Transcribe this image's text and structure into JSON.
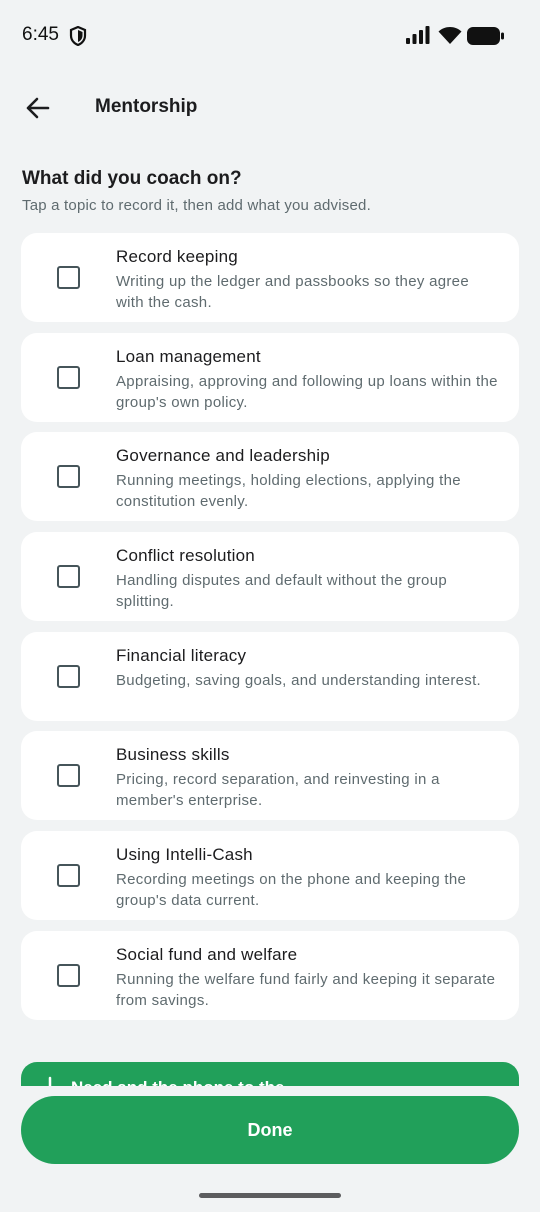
{
  "status_bar": {
    "time": "6:45",
    "icons": [
      "shield-icon",
      "signal-icon",
      "wifi-icon",
      "battery-icon"
    ]
  },
  "app_bar": {
    "back_icon": "arrow-back-icon",
    "title": "Mentorship"
  },
  "section": {
    "question": "What did you coach on?",
    "hint": "Tap a topic to record it, then add what you advised."
  },
  "topics": [
    {
      "title": "Record keeping",
      "desc": "Writing up the ledger and passbooks so they agree with the cash.",
      "checked": false
    },
    {
      "title": "Loan management",
      "desc": "Appraising, approving and following up loans within the group's own policy.",
      "checked": false
    },
    {
      "title": "Governance and leadership",
      "desc": "Running meetings, holding elections, applying the constitution evenly.",
      "checked": false
    },
    {
      "title": "Conflict resolution",
      "desc": "Handling disputes and default without the group splitting.",
      "checked": false
    },
    {
      "title": "Financial literacy",
      "desc": "Budgeting, saving goals, and understanding interest.",
      "checked": false
    },
    {
      "title": "Business skills",
      "desc": "Pricing, record separation, and reinvesting in a member's enterprise.",
      "checked": false
    },
    {
      "title": "Using Intelli-Cash",
      "desc": "Recording meetings on the phone and keeping the group's data current.",
      "checked": false
    },
    {
      "title": "Social fund and welfare",
      "desc": "Running the welfare fund fairly and keeping it separate from savings.",
      "checked": false
    }
  ],
  "banner": {
    "text": "Need and the phone to the",
    "icon": "info-icon"
  },
  "footer": {
    "done_label": "Done"
  },
  "colors": {
    "accent": "#21a05a",
    "background": "#f1f3f4",
    "card": "#ffffff",
    "muted_text": "#5f6b6f"
  }
}
